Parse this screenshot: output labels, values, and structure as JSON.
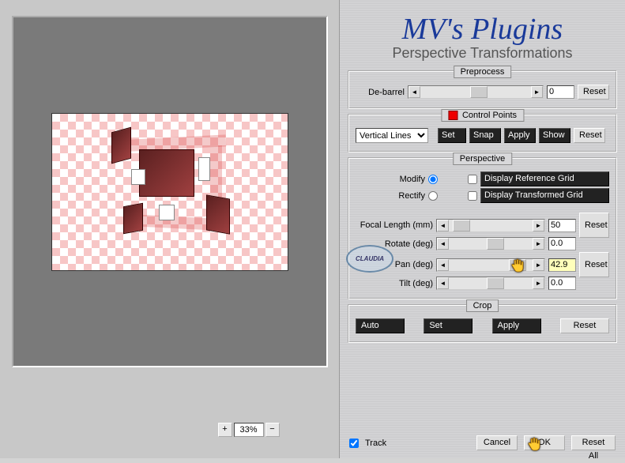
{
  "brand": {
    "logo": "MV's Plugins",
    "subtitle": "Perspective Transformations"
  },
  "zoom": {
    "minus": "−",
    "value": "33%",
    "plus": "+"
  },
  "preprocess": {
    "title": "Preprocess",
    "debarrel_label": "De-barrel",
    "debarrel_value": "0",
    "reset": "Reset"
  },
  "control_points": {
    "title": "Control Points",
    "mode": "Vertical Lines",
    "set": "Set",
    "snap": "Snap",
    "apply": "Apply",
    "show": "Show",
    "reset": "Reset"
  },
  "perspective": {
    "title": "Perspective",
    "modify_label": "Modify",
    "rectify_label": "Rectify",
    "ref_grid": "Display Reference Grid",
    "trans_grid": "Display Transformed Grid",
    "focal_label": "Focal Length (mm)",
    "focal_value": "50",
    "rotate_label": "Rotate (deg)",
    "rotate_value": "0.0",
    "pan_label": "Pan (deg)",
    "pan_value": "42.9",
    "tilt_label": "Tilt (deg)",
    "tilt_value": "0.0",
    "reset_top": "Reset",
    "reset_bottom": "Reset"
  },
  "crop": {
    "title": "Crop",
    "auto": "Auto",
    "set": "Set",
    "apply": "Apply",
    "reset": "Reset"
  },
  "footer": {
    "track": "Track",
    "cancel": "Cancel",
    "ok": "OK",
    "reset_all": "Reset All"
  },
  "watermark": "CLAUDIA"
}
